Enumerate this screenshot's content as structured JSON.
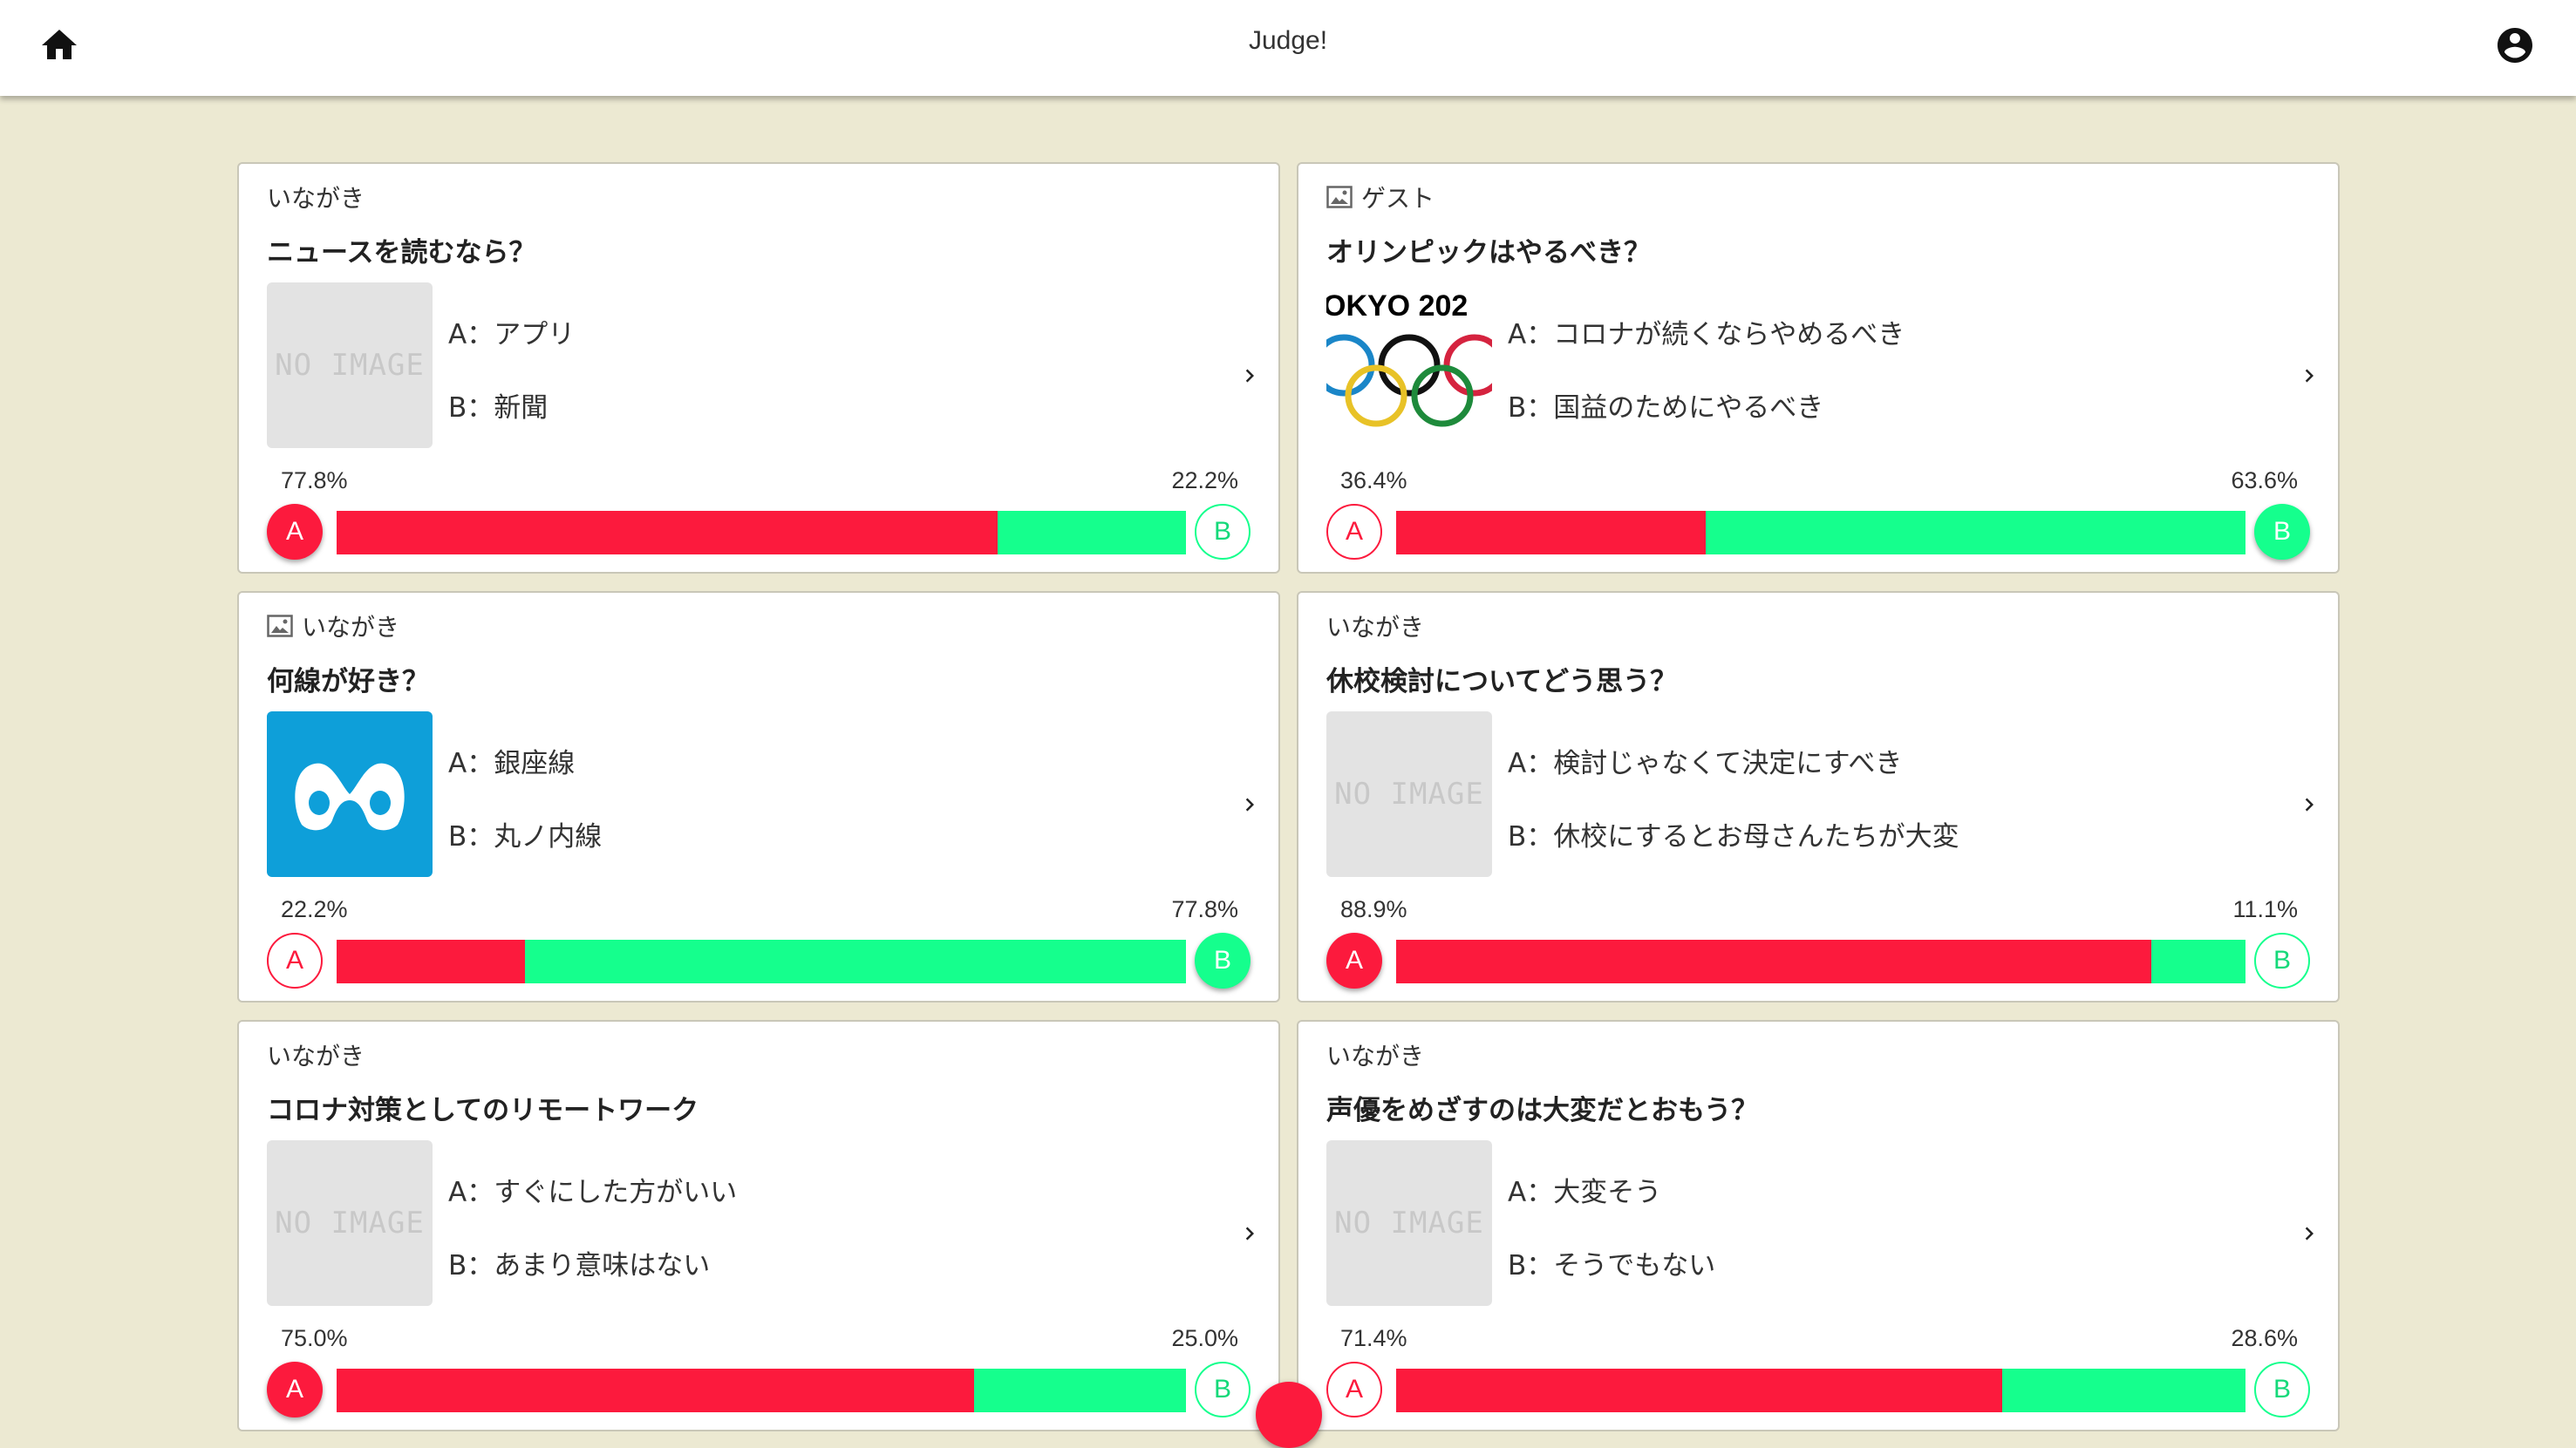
{
  "app": {
    "title": "Judge!",
    "home_icon": "home-icon",
    "account_icon": "account-circle-icon"
  },
  "colors": {
    "a": "#fc1a3d",
    "b": "#15ff8d",
    "background": "#ece9d2"
  },
  "option_prefix": {
    "a": "A：",
    "b": "B："
  },
  "cards": [
    {
      "author": "いながき",
      "has_image_icon": false,
      "question": "ニュースを読むなら？",
      "thumbnail": "no-image",
      "thumb_text": "NO IMAGE",
      "option_a": "A：アプリ",
      "option_b": "B：新聞",
      "pct_a": "77.8%",
      "pct_b": "22.2%",
      "ratio_a": 0.778,
      "winner": "A",
      "label_a": "A",
      "label_b": "B"
    },
    {
      "author": "ゲスト",
      "has_image_icon": true,
      "question": "オリンピックはやるべき？",
      "thumbnail": "tokyo-olympics-logo",
      "thumb_text": "OKYO 202",
      "option_a": "A：コロナが続くならやめるべき",
      "option_b": "B：国益のためにやるべき",
      "pct_a": "36.4%",
      "pct_b": "63.6%",
      "ratio_a": 0.364,
      "winner": "B",
      "label_a": "A",
      "label_b": "B"
    },
    {
      "author": "いながき",
      "has_image_icon": true,
      "question": "何線が好き？",
      "thumbnail": "tokyo-metro-logo",
      "thumb_text": "",
      "option_a": "A：銀座線",
      "option_b": "B：丸ノ内線",
      "pct_a": "22.2%",
      "pct_b": "77.8%",
      "ratio_a": 0.222,
      "winner": "B",
      "label_a": "A",
      "label_b": "B"
    },
    {
      "author": "いながき",
      "has_image_icon": false,
      "question": "休校検討についてどう思う？",
      "thumbnail": "no-image",
      "thumb_text": "NO IMAGE",
      "option_a": "A：検討じゃなくて決定にすべき",
      "option_b": "B：休校にするとお母さんたちが大変",
      "pct_a": "88.9%",
      "pct_b": "11.1%",
      "ratio_a": 0.889,
      "winner": "A",
      "label_a": "A",
      "label_b": "B"
    },
    {
      "author": "いながき",
      "has_image_icon": false,
      "question": "コロナ対策としてのリモートワーク",
      "thumbnail": "no-image",
      "thumb_text": "NO IMAGE",
      "option_a": "A：すぐにした方がいい",
      "option_b": "B：あまり意味はない",
      "pct_a": "75.0%",
      "pct_b": "25.0%",
      "ratio_a": 0.75,
      "winner": "A",
      "label_a": "A",
      "label_b": "B"
    },
    {
      "author": "いながき",
      "has_image_icon": false,
      "question": "声優をめざすのは大変だとおもう？",
      "thumbnail": "no-image",
      "thumb_text": "NO IMAGE",
      "option_a": "A：大変そう",
      "option_b": "B：そうでもない",
      "pct_a": "71.4%",
      "pct_b": "28.6%",
      "ratio_a": 0.714,
      "winner": "A",
      "label_a": "A",
      "label_b": "B"
    }
  ]
}
